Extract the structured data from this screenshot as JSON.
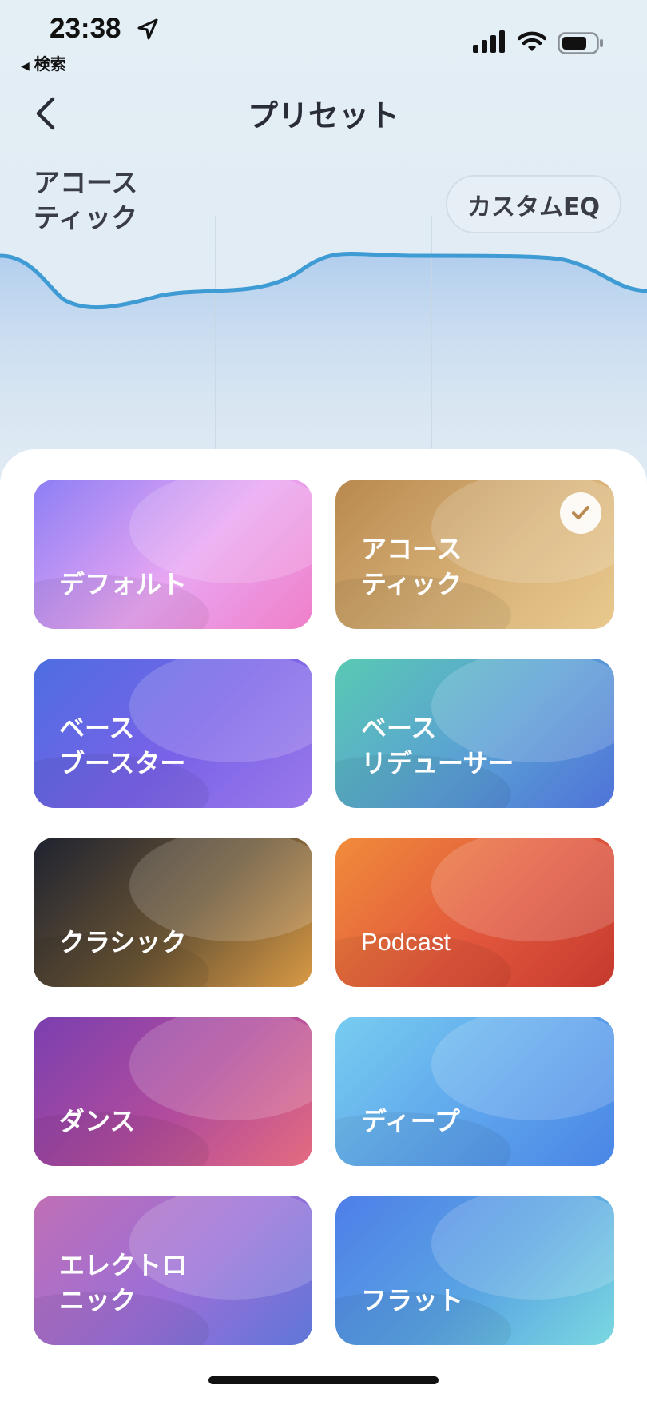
{
  "status_bar": {
    "time": "23:38",
    "back_app": "検索",
    "icons": [
      "location-arrow-icon",
      "cellular-signal-icon",
      "wifi-icon",
      "battery-icon"
    ]
  },
  "nav": {
    "title": "プリセット",
    "back_icon": "chevron-left-icon"
  },
  "current_preset": {
    "name": "アコース\nティック"
  },
  "custom_eq_button": "カスタムEQ",
  "accent_color": "#3f9bd4",
  "presets": [
    {
      "label": "デフォルト",
      "selected": false,
      "colors": [
        "#8c7ff5",
        "#e9a6f2",
        "#f07fc9"
      ]
    },
    {
      "label": "アコース\nティック",
      "selected": true,
      "colors": [
        "#b9894f",
        "#d7b177",
        "#e9c98e"
      ]
    },
    {
      "label": "ベース\nブースター",
      "selected": false,
      "colors": [
        "#4d6ee0",
        "#7a62e8",
        "#9a79ea"
      ]
    },
    {
      "label": "ベース\nリデューサー",
      "selected": false,
      "colors": [
        "#59c9b3",
        "#5a9fd5",
        "#4f73d8"
      ]
    },
    {
      "label": "クラシック",
      "selected": false,
      "colors": [
        "#1e2230",
        "#6b5534",
        "#d99a45"
      ]
    },
    {
      "label": "Podcast",
      "selected": false,
      "colors": [
        "#f08c3b",
        "#e2573c",
        "#c5392e"
      ]
    },
    {
      "label": "ダンス",
      "selected": false,
      "colors": [
        "#7a3fb0",
        "#b24c9c",
        "#e46b7f"
      ]
    },
    {
      "label": "ディープ",
      "selected": false,
      "colors": [
        "#78cdf0",
        "#5ea4ec",
        "#4a85e6"
      ]
    },
    {
      "label": "エレクトロ\nニック",
      "selected": false,
      "colors": [
        "#c06fb5",
        "#9a6fd8",
        "#5f76d8"
      ]
    },
    {
      "label": "フラット",
      "selected": false,
      "colors": [
        "#4e7ee8",
        "#5aa5e3",
        "#7ad8e0"
      ]
    }
  ]
}
